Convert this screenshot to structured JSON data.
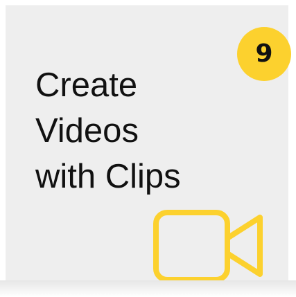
{
  "card": {
    "number": "9",
    "title_lines": [
      "Create",
      "Videos",
      "with Clips"
    ],
    "icon": "video-camera-icon"
  },
  "colors": {
    "accent": "#fcd12e",
    "card_background": "#eeeeee",
    "text": "#111111"
  }
}
